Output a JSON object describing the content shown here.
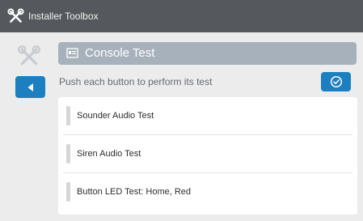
{
  "app": {
    "title": "Installer Toolbox"
  },
  "icons": {
    "topbar": "tools-icon",
    "sidebar": "tools-icon",
    "back": "left-triangle-icon",
    "console": "console-icon",
    "confirm": "check-circle-icon"
  },
  "colors": {
    "topbar_background": "#55585c",
    "page_background": "#ececec",
    "accent": "#1b7fc0",
    "console_header": "#a6b1bb"
  },
  "console": {
    "title": "Console Test"
  },
  "instructions": "Push each button to perform its test",
  "tests": [
    {
      "label": "Sounder Audio Test"
    },
    {
      "label": "Siren Audio Test"
    },
    {
      "label": "Button LED Test: Home, Red"
    }
  ]
}
